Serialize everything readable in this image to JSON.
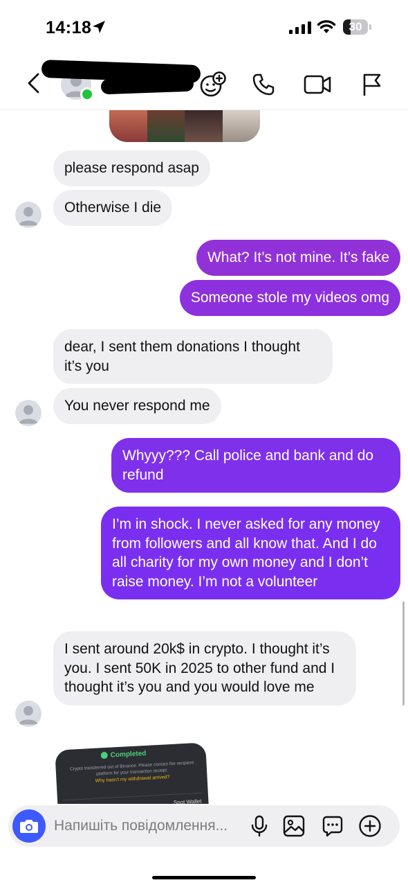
{
  "status_bar": {
    "time": "14:18",
    "battery": "30",
    "battery_level": 0.3
  },
  "header": {
    "back_icon": "chevron-left-icon",
    "effects_icon": "face-effects-icon",
    "call_icon": "phone-icon",
    "video_icon": "video-camera-icon",
    "report_icon": "flag-icon"
  },
  "messages": [
    {
      "direction": "in",
      "text": "please respond asap"
    },
    {
      "direction": "in",
      "text": "Otherwise I die"
    },
    {
      "direction": "out",
      "text": "What? It’s not mine. It’s fake"
    },
    {
      "direction": "out",
      "text": "Someone stole my videos omg"
    },
    {
      "direction": "in",
      "text": "dear, I sent them donations I thought it’s you"
    },
    {
      "direction": "in",
      "text": "You never respond me"
    },
    {
      "direction": "out",
      "text": "Whyyy??? Call police and bank and do refund"
    },
    {
      "direction": "out",
      "text": "I’m in shock. I never asked for any money from followers and all know that. And I do all charity for my own money and I don’t raise money. I’m not a volunteer"
    },
    {
      "direction": "in",
      "text": "I sent around 20k$ in crypto. I thought it’s you. I sent 50K in 2025 to other fund and I thought it’s you and you would love me"
    }
  ],
  "shared_screenshot": {
    "status": "Completed",
    "note": "Crypto transferred out of Binance. Please contact the recipient platform for your transaction receipt.",
    "question": "Why hasn't my withdrawal arrived?",
    "wallet": "Spot Wallet"
  },
  "composer": {
    "placeholder": "Напишіть повідомлення...",
    "value": "",
    "camera_icon": "camera-icon",
    "mic_icon": "microphone-icon",
    "gallery_icon": "gallery-icon",
    "sticker_icon": "sticker-icon",
    "plus_icon": "plus-icon"
  },
  "colors": {
    "incoming_bubble": "#efeff1",
    "outgoing_start": "#9a32d6",
    "outgoing_end": "#7a2ff0",
    "camera_button": "#3d5afe",
    "online": "#22c33a"
  }
}
